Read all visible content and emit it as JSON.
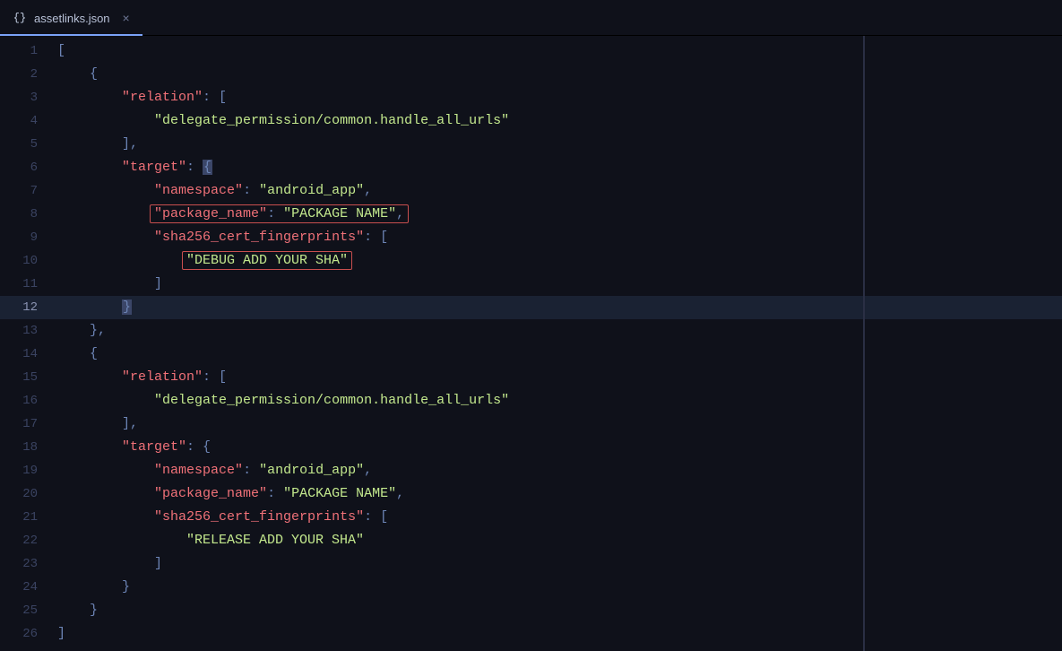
{
  "tab": {
    "icon_label": "{}",
    "filename": "assetlinks.json",
    "close_glyph": "×"
  },
  "active_line": 12,
  "highlighted_lines": [
    8,
    10
  ],
  "code": [
    {
      "num": 1,
      "indent": 0,
      "tokens": [
        {
          "t": "[",
          "c": "punct"
        }
      ]
    },
    {
      "num": 2,
      "indent": 1,
      "tokens": [
        {
          "t": "{",
          "c": "punct"
        }
      ]
    },
    {
      "num": 3,
      "indent": 2,
      "tokens": [
        {
          "t": "\"relation\"",
          "c": "key"
        },
        {
          "t": ": [",
          "c": "punct"
        }
      ]
    },
    {
      "num": 4,
      "indent": 3,
      "tokens": [
        {
          "t": "\"delegate_permission/common.handle_all_urls\"",
          "c": "str"
        }
      ]
    },
    {
      "num": 5,
      "indent": 2,
      "tokens": [
        {
          "t": "],",
          "c": "punct"
        }
      ]
    },
    {
      "num": 6,
      "indent": 2,
      "tokens": [
        {
          "t": "\"target\"",
          "c": "key"
        },
        {
          "t": ": ",
          "c": "punct"
        },
        {
          "t": "{",
          "c": "punct",
          "cursor": true
        }
      ]
    },
    {
      "num": 7,
      "indent": 3,
      "tokens": [
        {
          "t": "\"namespace\"",
          "c": "key"
        },
        {
          "t": ": ",
          "c": "punct"
        },
        {
          "t": "\"android_app\"",
          "c": "str"
        },
        {
          "t": ",",
          "c": "punct"
        }
      ]
    },
    {
      "num": 8,
      "indent": 3,
      "tokens": [
        {
          "t": "\"package_name\"",
          "c": "key"
        },
        {
          "t": ": ",
          "c": "punct"
        },
        {
          "t": "\"PACKAGE NAME\"",
          "c": "str"
        },
        {
          "t": ",",
          "c": "punct"
        }
      ]
    },
    {
      "num": 9,
      "indent": 3,
      "tokens": [
        {
          "t": "\"sha256_cert_fingerprints\"",
          "c": "key"
        },
        {
          "t": ": [",
          "c": "punct"
        }
      ]
    },
    {
      "num": 10,
      "indent": 4,
      "tokens": [
        {
          "t": "\"DEBUG ADD YOUR SHA\"",
          "c": "str"
        }
      ]
    },
    {
      "num": 11,
      "indent": 3,
      "tokens": [
        {
          "t": "]",
          "c": "punct"
        }
      ]
    },
    {
      "num": 12,
      "indent": 2,
      "tokens": [
        {
          "t": "}",
          "c": "punct",
          "cursor": true
        }
      ]
    },
    {
      "num": 13,
      "indent": 1,
      "tokens": [
        {
          "t": "},",
          "c": "punct"
        }
      ]
    },
    {
      "num": 14,
      "indent": 1,
      "tokens": [
        {
          "t": "{",
          "c": "punct"
        }
      ]
    },
    {
      "num": 15,
      "indent": 2,
      "tokens": [
        {
          "t": "\"relation\"",
          "c": "key"
        },
        {
          "t": ": [",
          "c": "punct"
        }
      ]
    },
    {
      "num": 16,
      "indent": 3,
      "tokens": [
        {
          "t": "\"delegate_permission/common.handle_all_urls\"",
          "c": "str"
        }
      ]
    },
    {
      "num": 17,
      "indent": 2,
      "tokens": [
        {
          "t": "],",
          "c": "punct"
        }
      ]
    },
    {
      "num": 18,
      "indent": 2,
      "tokens": [
        {
          "t": "\"target\"",
          "c": "key"
        },
        {
          "t": ": {",
          "c": "punct"
        }
      ]
    },
    {
      "num": 19,
      "indent": 3,
      "tokens": [
        {
          "t": "\"namespace\"",
          "c": "key"
        },
        {
          "t": ": ",
          "c": "punct"
        },
        {
          "t": "\"android_app\"",
          "c": "str"
        },
        {
          "t": ",",
          "c": "punct"
        }
      ]
    },
    {
      "num": 20,
      "indent": 3,
      "tokens": [
        {
          "t": "\"package_name\"",
          "c": "key"
        },
        {
          "t": ": ",
          "c": "punct"
        },
        {
          "t": "\"PACKAGE NAME\"",
          "c": "str"
        },
        {
          "t": ",",
          "c": "punct"
        }
      ]
    },
    {
      "num": 21,
      "indent": 3,
      "tokens": [
        {
          "t": "\"sha256_cert_fingerprints\"",
          "c": "key"
        },
        {
          "t": ": [",
          "c": "punct"
        }
      ]
    },
    {
      "num": 22,
      "indent": 4,
      "tokens": [
        {
          "t": "\"RELEASE ADD YOUR SHA\"",
          "c": "str"
        }
      ]
    },
    {
      "num": 23,
      "indent": 3,
      "tokens": [
        {
          "t": "]",
          "c": "punct"
        }
      ]
    },
    {
      "num": 24,
      "indent": 2,
      "tokens": [
        {
          "t": "}",
          "c": "punct"
        }
      ]
    },
    {
      "num": 25,
      "indent": 1,
      "tokens": [
        {
          "t": "}",
          "c": "punct"
        }
      ]
    },
    {
      "num": 26,
      "indent": 0,
      "tokens": [
        {
          "t": "]",
          "c": "punct"
        }
      ]
    }
  ]
}
